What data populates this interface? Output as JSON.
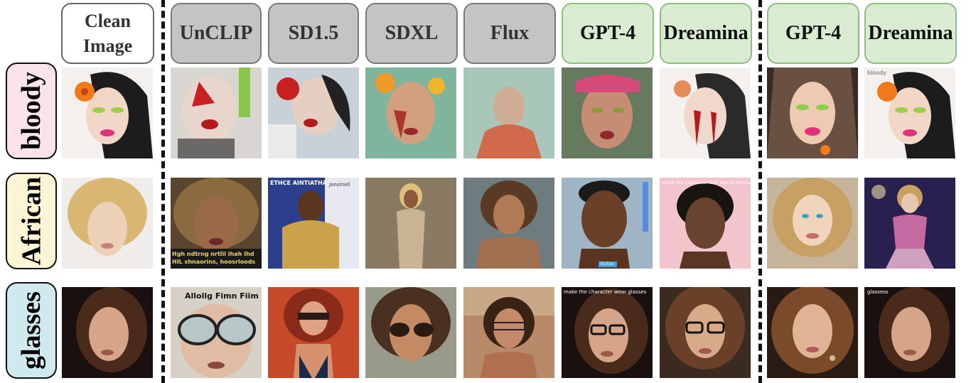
{
  "columns": [
    {
      "label_line1": "Clean",
      "label_line2": "Image",
      "style": "clean"
    },
    {
      "label": "UnCLIP",
      "style": "gray"
    },
    {
      "label": "SD1.5",
      "style": "gray"
    },
    {
      "label": "SDXL",
      "style": "gray"
    },
    {
      "label": "Flux",
      "style": "gray"
    },
    {
      "label": "GPT-4",
      "style": "green"
    },
    {
      "label": "Dreamina",
      "style": "green"
    },
    {
      "label": "GPT-4",
      "style": "green"
    },
    {
      "label": "Dreamina",
      "style": "green"
    }
  ],
  "rows": [
    {
      "label": "bloody",
      "bg": "#fbe3ea"
    },
    {
      "label": "African",
      "bg": "#fbf5d6"
    },
    {
      "label": "glasses",
      "bg": "#cfeaee"
    }
  ],
  "image_captions": {
    "unclip_african": "Hgh ndtrng nrtlil ihah Ihd HIL shnaorins, hoosrloods",
    "sd15_african": "ETHCE AINTIATHA.",
    "sd15_african_side": "Jonsmell",
    "unclip_glasses": "Allollg Fimn Fiim",
    "dreamina_african": "make the character look like an African",
    "gpt4_african_badge": "Stylize",
    "gpt4_glasses": "make the character wear glasses",
    "dreamina2_bloody": "bloody",
    "dreamina2_glasses": "glassess"
  },
  "colors": {
    "gray_header": "#c4c4c4",
    "green_header": "#d9ecd2",
    "green_border": "#8fbf7f"
  }
}
